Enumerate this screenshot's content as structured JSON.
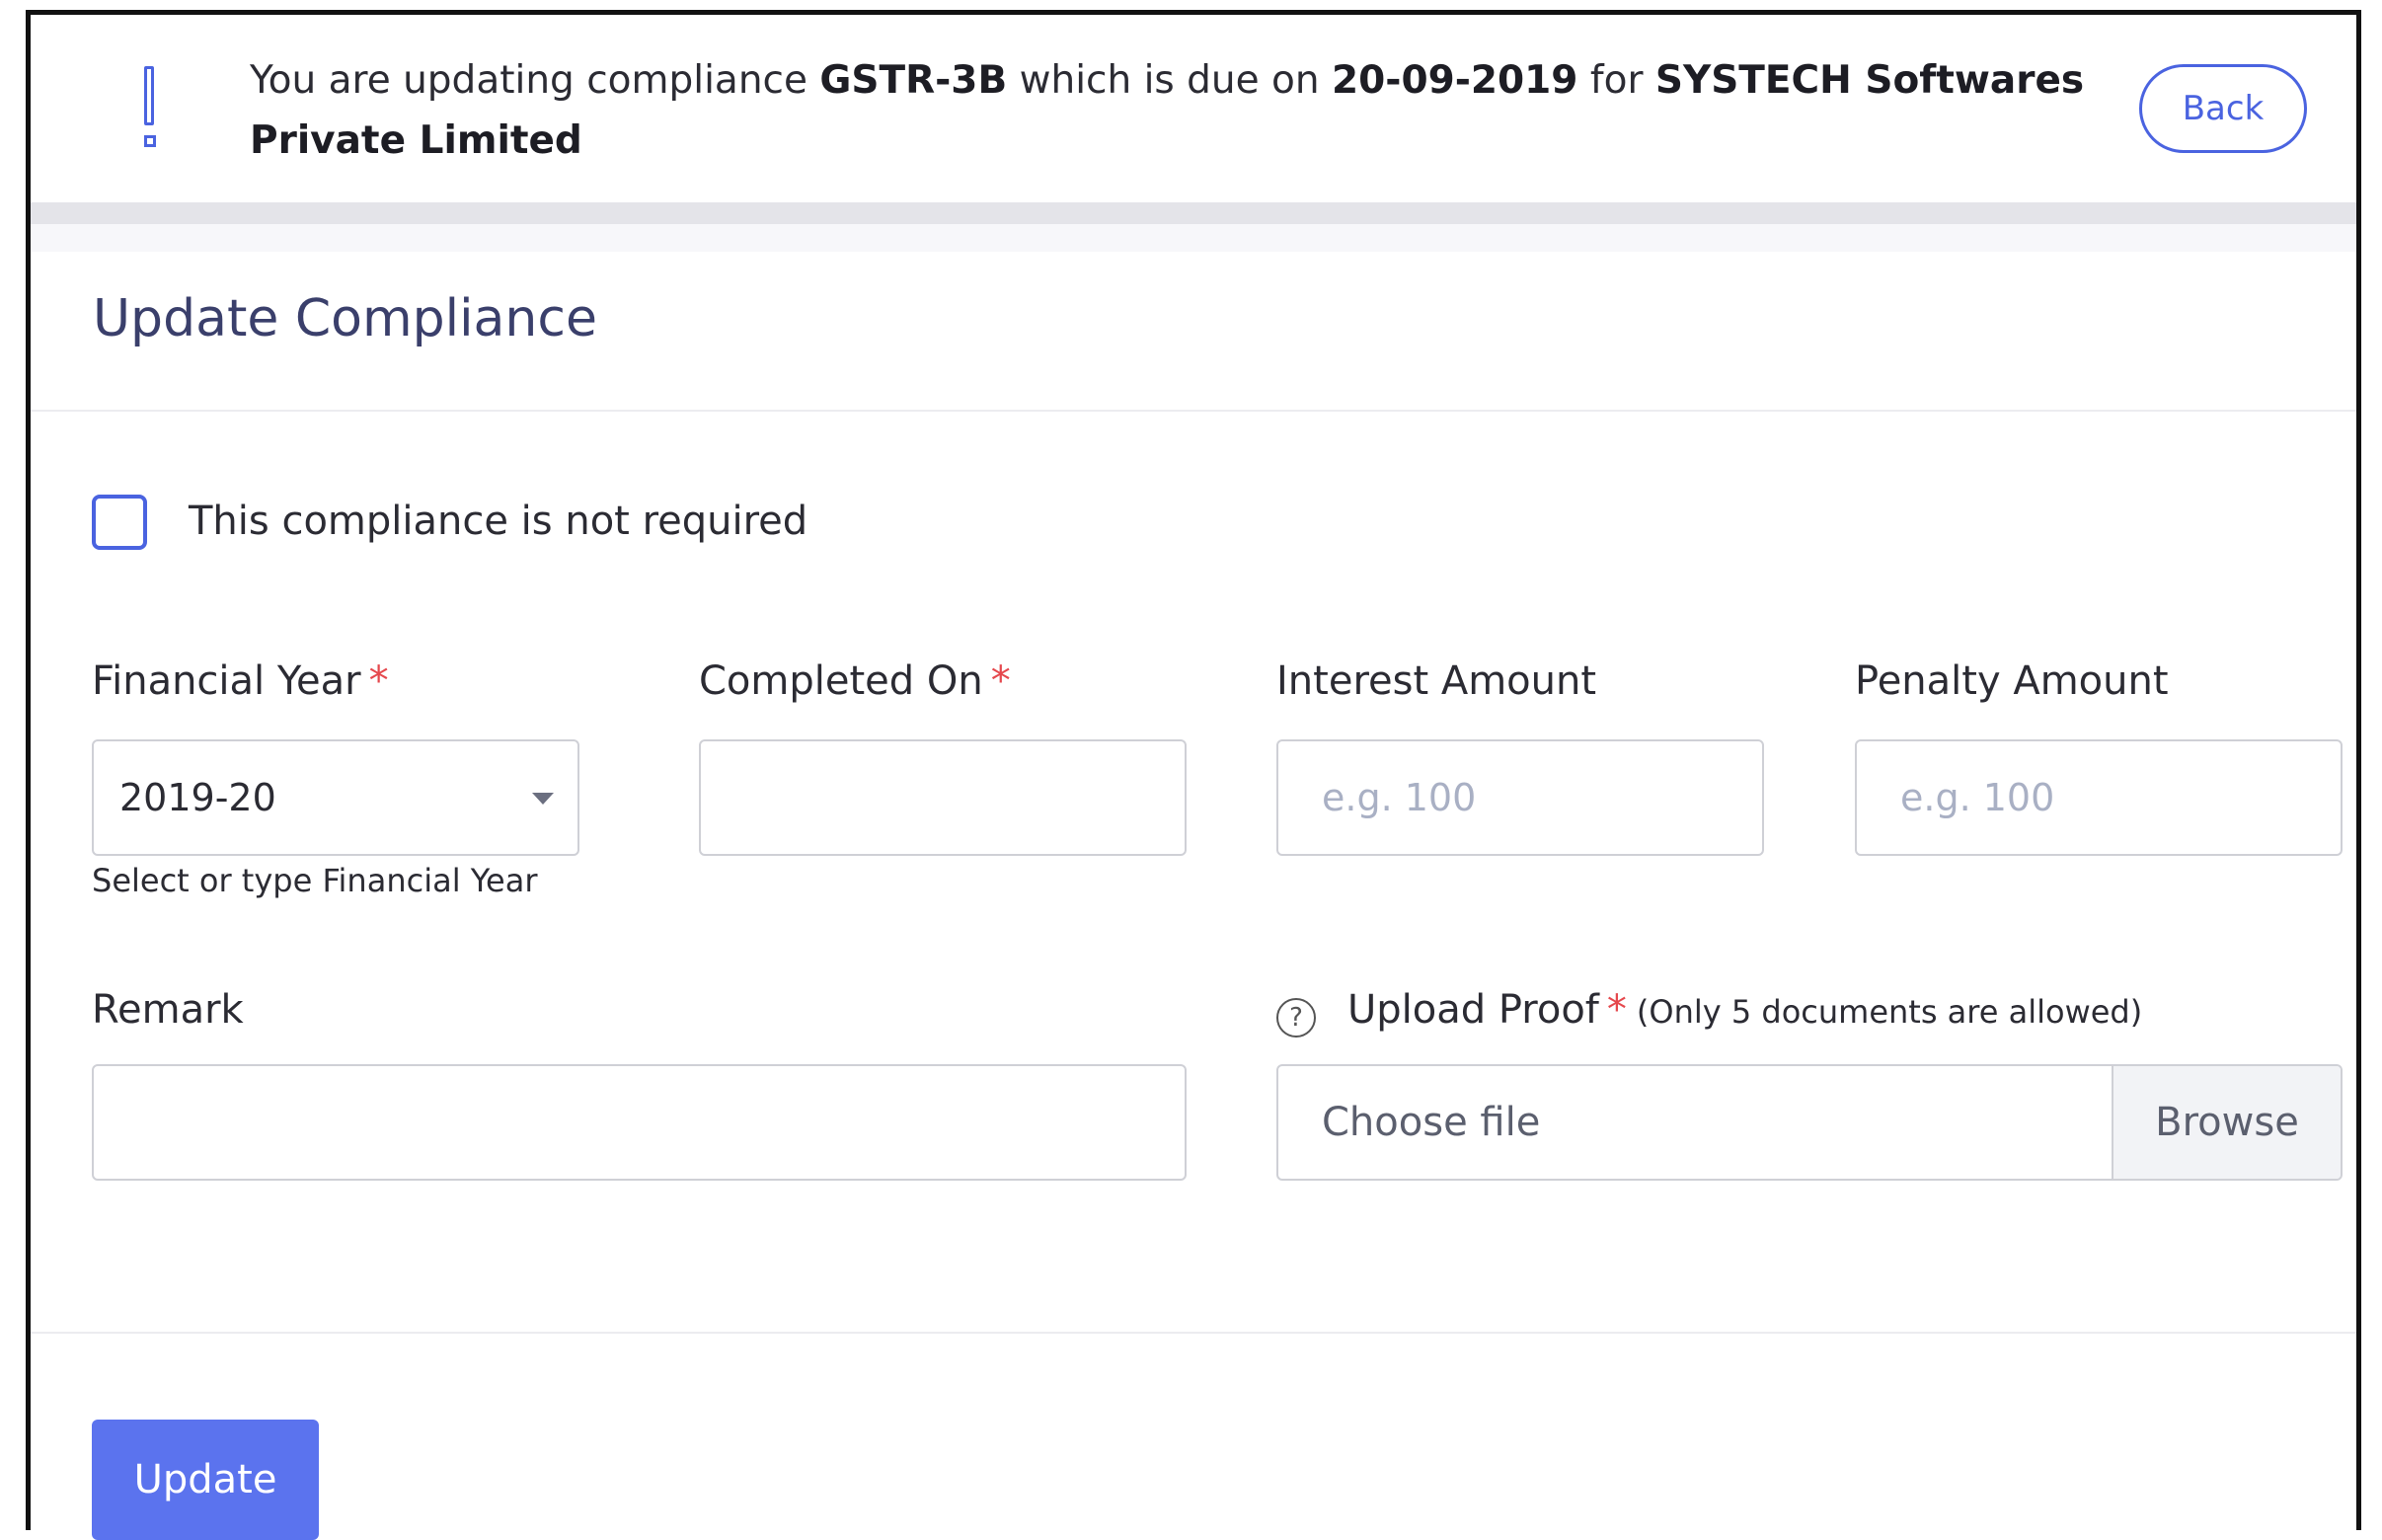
{
  "banner": {
    "text_prefix": "You are updating compliance ",
    "compliance_code": "GSTR-3B",
    "text_mid": " which is due on ",
    "due_date": "20-09-2019",
    "text_for": " for ",
    "company": "SYSTECH Softwares Private Limited",
    "back_label": "Back"
  },
  "title": "Update Compliance",
  "checkbox": {
    "label": "This compliance is not required",
    "checked": false
  },
  "fields": {
    "financial_year": {
      "label": "Financial Year",
      "required_mark": "*",
      "value": "2019-20",
      "help": "Select or type Financial Year"
    },
    "completed_on": {
      "label": "Completed On",
      "required_mark": "*",
      "value": ""
    },
    "interest_amount": {
      "label": "Interest Amount",
      "placeholder": "e.g. 100"
    },
    "penalty_amount": {
      "label": "Penalty Amount",
      "placeholder": "e.g. 100"
    },
    "remark": {
      "label": "Remark",
      "value": ""
    },
    "upload_proof": {
      "label": "Upload Proof",
      "required_mark": "*",
      "note": "(Only 5 documents are allowed)",
      "file_text": "Choose file",
      "browse_label": "Browse",
      "help_icon": "?"
    }
  },
  "actions": {
    "update_label": "Update"
  },
  "colors": {
    "accent": "#4a63e0",
    "button": "#5b73ee",
    "required": "#e5484d"
  }
}
